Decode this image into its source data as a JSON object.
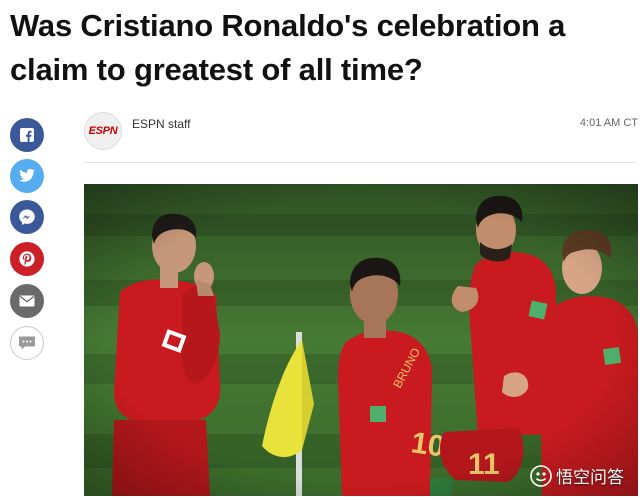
{
  "article": {
    "headline": "Was Cristiano Ronaldo's celebration a claim to greatest of all time?"
  },
  "share": {
    "buttons": [
      {
        "name": "facebook",
        "icon": "facebook-icon",
        "color": "#3b5998"
      },
      {
        "name": "twitter",
        "icon": "twitter-icon",
        "color": "#55acee"
      },
      {
        "name": "messenger",
        "icon": "messenger-icon",
        "color": "#3b5998"
      },
      {
        "name": "pinterest",
        "icon": "pinterest-icon",
        "color": "#cb2027"
      },
      {
        "name": "email",
        "icon": "envelope-icon",
        "color": "#666666"
      },
      {
        "name": "comments",
        "icon": "comment-icon",
        "color": "#ffffff"
      }
    ]
  },
  "byline": {
    "logo_text": "ESPN",
    "author": "ESPN staff",
    "time": "4:01 AM CT"
  },
  "photo": {
    "jersey_numbers": [
      "10",
      "11"
    ],
    "watermark_text": "悟空问答"
  },
  "colors": {
    "headline": "#111111",
    "pitch": "#3f6b2f",
    "kit_red": "#d11f22",
    "flag_yellow": "#e9e23a"
  }
}
